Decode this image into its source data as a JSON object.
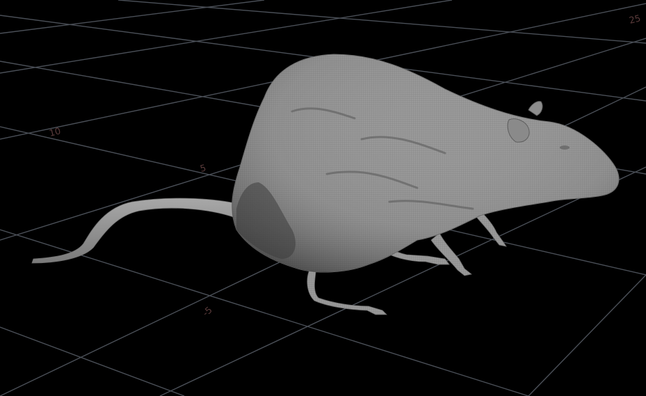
{
  "viewport": {
    "background_color": "#000000",
    "grid_color": "#4a4f57",
    "label_color": "#5a3b3b",
    "model_color": "#8f8f8f"
  },
  "grid_labels": {
    "label_10": "10",
    "label_5": "5",
    "label_neg5": "-5",
    "label_top_right": "25"
  },
  "model": {
    "icon": "rat-mesh-icon"
  }
}
